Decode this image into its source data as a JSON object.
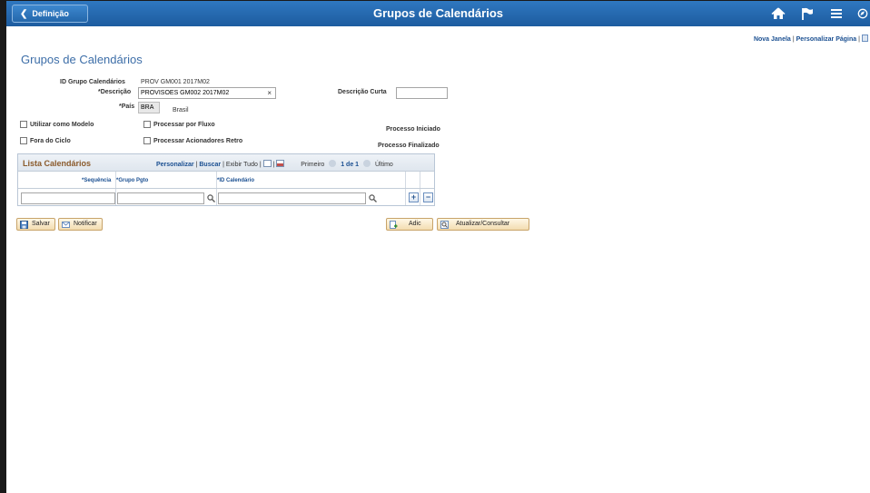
{
  "header": {
    "back_label": "Definição",
    "title": "Grupos de Calendários",
    "icons": [
      "home-icon",
      "flag-icon",
      "menu-icon",
      "navigator-icon"
    ]
  },
  "page_links": {
    "new_window": "Nova Janela",
    "personalize": "Personalizar Página"
  },
  "page_title": "Grupos de Calendários",
  "form": {
    "group_id_label": "ID Grupo Calendários",
    "group_id_value": "PROV GM001 2017M02",
    "description_label": "*Descrição",
    "description_value": "PROVISOES GM002 2017M02",
    "short_desc_label": "Descrição Curta",
    "short_desc_value": "",
    "country_label": "*País",
    "country_value": "BRA",
    "country_desc": "Brasil",
    "use_as_model_label": "Utilizar como Modelo",
    "process_by_flow_label": "Processar por Fluxo",
    "off_cycle_label": "Fora do Ciclo",
    "process_retro_label": "Processar Acionadores Retro",
    "process_started_label": "Processo Iniciado",
    "process_finished_label": "Processo Finalizado"
  },
  "grid": {
    "title": "Lista Calendários",
    "personalize": "Personalizar",
    "search": "Buscar",
    "show_all": "Exibir Tudo",
    "first": "Primeiro",
    "range": "1 de 1",
    "last": "Último",
    "columns": [
      "*Sequência",
      "*Grupo Pgto",
      "*ID Calendário"
    ],
    "rows": [
      {
        "sequence": "",
        "pay_group": "",
        "calendar_id": ""
      }
    ]
  },
  "buttons": {
    "save": "Salvar",
    "notify": "Notificar",
    "add": "Adic",
    "update_display": "Atualizar/Consultar"
  }
}
